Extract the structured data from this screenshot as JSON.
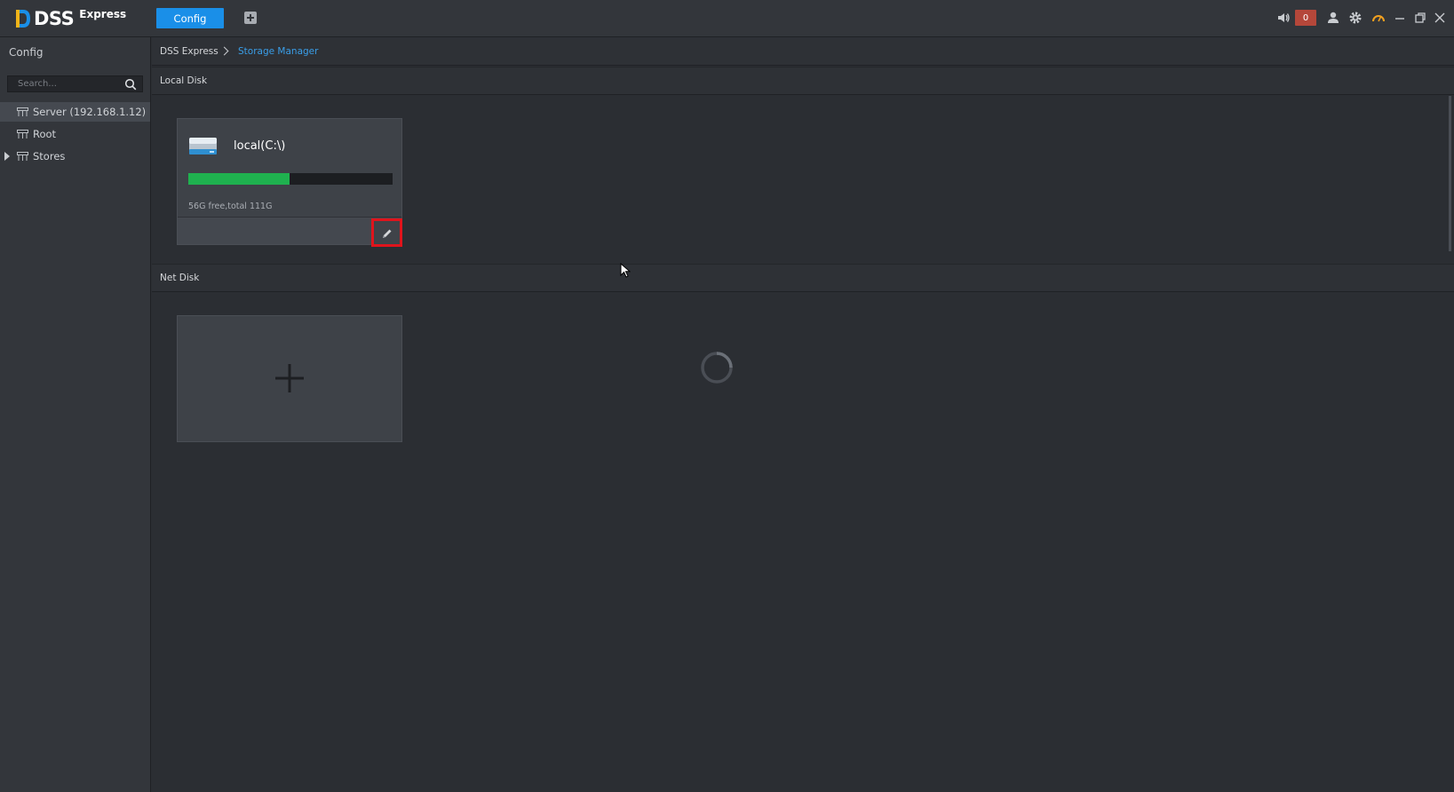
{
  "app": {
    "logo_brand": "DSS",
    "logo_product": "Express",
    "tab_config": "Config",
    "alarm_count": "0"
  },
  "icons": {
    "volume": "speaker-icon",
    "user": "user-icon",
    "settings": "gear-icon",
    "performance": "gauge-icon",
    "minimize": "minimize-icon",
    "restore": "restore-icon",
    "close": "close-icon",
    "search": "search-icon",
    "edit": "pencil-icon",
    "add": "plus-icon"
  },
  "sidebar": {
    "title": "Config",
    "search_placeholder": "Search...",
    "tree": [
      {
        "label": "Server (192.168.1.12)",
        "selected": true
      },
      {
        "label": "Root",
        "selected": false
      },
      {
        "label": "Stores",
        "selected": false
      }
    ]
  },
  "breadcrumb": {
    "root": "DSS Express",
    "current": "Storage Manager"
  },
  "local_disk": {
    "header": "Local Disk",
    "disks": [
      {
        "name": "local(C:\\)",
        "usage_text": "56G free,total 111G",
        "used_fraction": 0.495
      }
    ]
  },
  "net_disk": {
    "header": "Net Disk"
  },
  "colors": {
    "accent": "#1a8fe8",
    "link": "#3a9ee8",
    "usage_bar": "#1fb14f",
    "highlight_box": "#e0141c",
    "alarm_badge": "#b5473a"
  }
}
